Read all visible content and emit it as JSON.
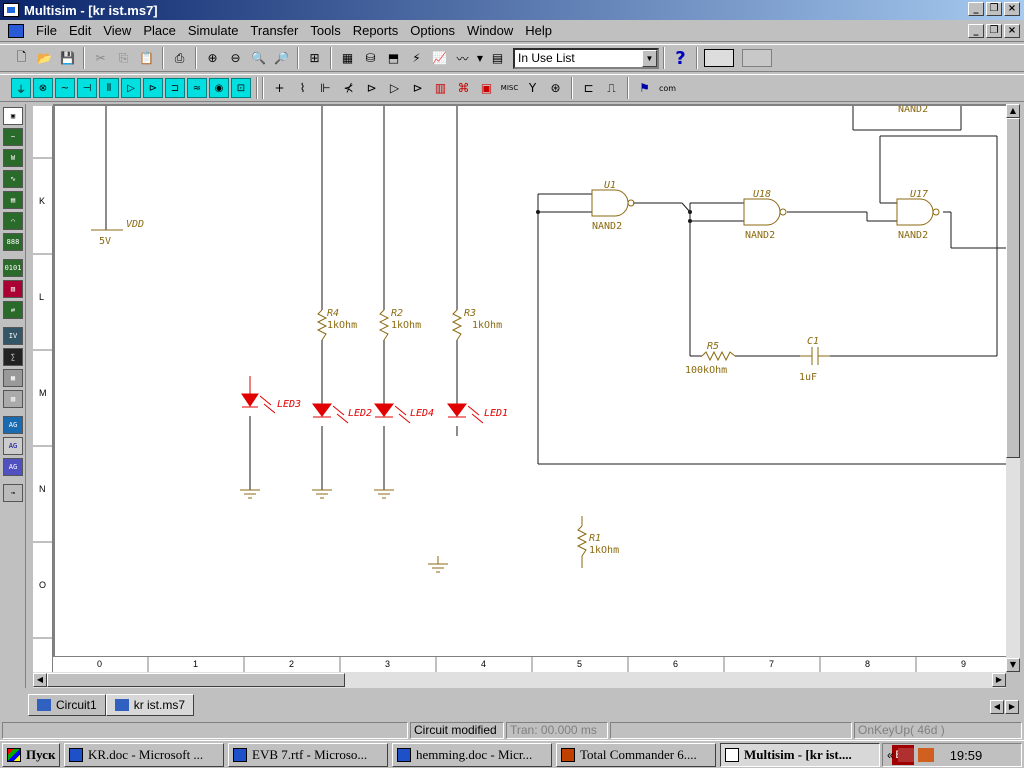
{
  "window": {
    "title": "Multisim - [kr ist.ms7]"
  },
  "menu": [
    "File",
    "Edit",
    "View",
    "Place",
    "Simulate",
    "Transfer",
    "Tools",
    "Reports",
    "Options",
    "Window",
    "Help"
  ],
  "toolbar": {
    "in_use_list": "In Use List",
    "help_symbol": "?"
  },
  "ruler": {
    "rows": [
      "K",
      "L",
      "M",
      "N",
      "O"
    ],
    "cols": [
      "0",
      "1",
      "2",
      "3",
      "4",
      "5",
      "6",
      "7",
      "8",
      "9"
    ]
  },
  "schematic": {
    "vdd": {
      "name": "VDD",
      "value": "5V"
    },
    "resistors": [
      {
        "ref": "R4",
        "value": "1kOhm"
      },
      {
        "ref": "R2",
        "value": "1kOhm"
      },
      {
        "ref": "R3",
        "value": "1kOhm"
      },
      {
        "ref": "R1",
        "value": "1kOhm"
      },
      {
        "ref": "R5",
        "value": "100kOhm"
      }
    ],
    "capacitor": {
      "ref": "C1",
      "value": "1uF"
    },
    "leds": [
      "LED3",
      "LED2",
      "LED4",
      "LED1"
    ],
    "gates": [
      {
        "ref": "U1",
        "type": "NAND2"
      },
      {
        "ref": "U18",
        "type": "NAND2"
      },
      {
        "ref": "U17",
        "type": "NAND2"
      }
    ],
    "top_partial_label": "NAND2"
  },
  "tabs": [
    "Circuit1",
    "kr ist.ms7"
  ],
  "status": {
    "msg": "Circuit modified",
    "tran": "Tran: 00.000 ms",
    "key": "OnKeyUp( 46d )"
  },
  "taskbar": {
    "start": "Пуск",
    "tasks": [
      "KR.doc - Microsoft ...",
      "EVB 7.rtf - Microso...",
      "hemming.doc - Micr...",
      "Total Commander 6....",
      "Multisim - [kr ist...."
    ],
    "lang": "EN",
    "time": "19:59"
  },
  "colors": {
    "wire": "#1a1a1a",
    "component": "#8a6a10",
    "led": "#e00000",
    "title_start": "#0a246a",
    "title_end": "#a6caf0"
  }
}
